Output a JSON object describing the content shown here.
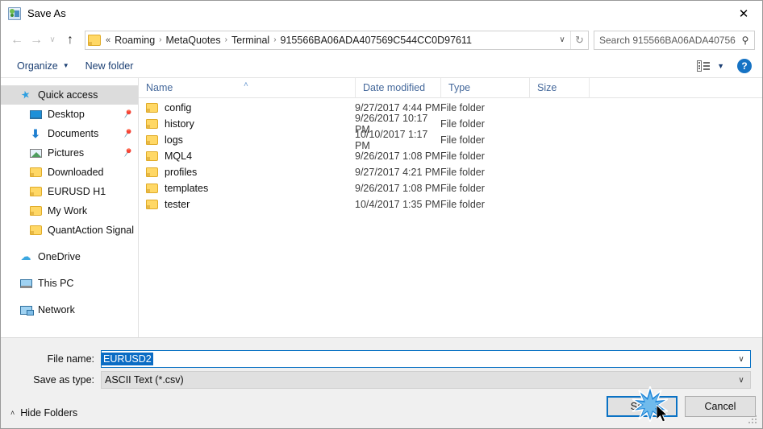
{
  "window": {
    "title": "Save As",
    "title_icon": "save-as-app-icon",
    "close_label": "✕"
  },
  "nav": {
    "back_icon": "←",
    "forward_icon": "→",
    "recent_icon": "∨",
    "up_icon": "↑",
    "breadcrumb_sep": "›",
    "breadcrumb_root": "«",
    "breadcrumb": [
      "Roaming",
      "MetaQuotes",
      "Terminal",
      "915566BA06ADA407569C544CC0D97611"
    ],
    "address_chevron": "∨",
    "refresh_icon": "↻"
  },
  "search": {
    "placeholder": "Search 915566BA06ADA40756…",
    "icon": "⚲"
  },
  "toolbar": {
    "organize_label": "Organize",
    "organize_caret": "▼",
    "new_folder_label": "New folder",
    "view_caret": "▼",
    "help_label": "?"
  },
  "sidebar": {
    "items": [
      {
        "label": "Quick access",
        "icon": "star-icon",
        "level": 0,
        "selected": true,
        "pinned": false
      },
      {
        "label": "Desktop",
        "icon": "desktop-icon",
        "level": 1,
        "selected": false,
        "pinned": true
      },
      {
        "label": "Documents",
        "icon": "download-icon",
        "level": 1,
        "selected": false,
        "pinned": true
      },
      {
        "label": "Pictures",
        "icon": "picture-icon",
        "level": 1,
        "selected": false,
        "pinned": true
      },
      {
        "label": "Downloaded",
        "icon": "folder-icon",
        "level": 1,
        "selected": false,
        "pinned": false
      },
      {
        "label": "EURUSD H1",
        "icon": "folder-icon",
        "level": 1,
        "selected": false,
        "pinned": false
      },
      {
        "label": "My Work",
        "icon": "folder-icon",
        "level": 1,
        "selected": false,
        "pinned": false
      },
      {
        "label": "QuantAction Signal",
        "icon": "folder-icon",
        "level": 1,
        "selected": false,
        "pinned": false
      },
      {
        "label": "OneDrive",
        "icon": "cloud-icon",
        "level": 0,
        "selected": false,
        "pinned": false,
        "gap_before": true
      },
      {
        "label": "This PC",
        "icon": "pc-icon",
        "level": 0,
        "selected": false,
        "pinned": false,
        "gap_before": true
      },
      {
        "label": "Network",
        "icon": "network-icon",
        "level": 0,
        "selected": false,
        "pinned": false,
        "gap_before": true
      }
    ],
    "pin_icon": "📌"
  },
  "filelist": {
    "columns": [
      "Name",
      "Date modified",
      "Type",
      "Size"
    ],
    "sort_caret": "˄",
    "rows": [
      {
        "name": "config",
        "date": "9/27/2017 4:44 PM",
        "type": "File folder",
        "size": ""
      },
      {
        "name": "history",
        "date": "9/26/2017 10:17 PM",
        "type": "File folder",
        "size": ""
      },
      {
        "name": "logs",
        "date": "10/10/2017 1:17 PM",
        "type": "File folder",
        "size": ""
      },
      {
        "name": "MQL4",
        "date": "9/26/2017 1:08 PM",
        "type": "File folder",
        "size": ""
      },
      {
        "name": "profiles",
        "date": "9/27/2017 4:21 PM",
        "type": "File folder",
        "size": ""
      },
      {
        "name": "templates",
        "date": "9/26/2017 1:08 PM",
        "type": "File folder",
        "size": ""
      },
      {
        "name": "tester",
        "date": "10/4/2017 1:35 PM",
        "type": "File folder",
        "size": ""
      }
    ]
  },
  "form": {
    "filename_label": "File name:",
    "filename_value": "EURUSD2",
    "filetype_label": "Save as type:",
    "filetype_value": "ASCII Text (*.csv)",
    "dropdown_caret": "∨"
  },
  "footer": {
    "hide_folders_label": "Hide Folders",
    "hide_folders_caret": "˄",
    "save_label": "Save",
    "cancel_label": "Cancel"
  },
  "colors": {
    "accent_blue": "#0a72c4",
    "folder_yellow": "#ffd866",
    "column_header_text": "#44689b",
    "command_link": "#1b3f73",
    "selection_blue": "#0b6cc4"
  }
}
